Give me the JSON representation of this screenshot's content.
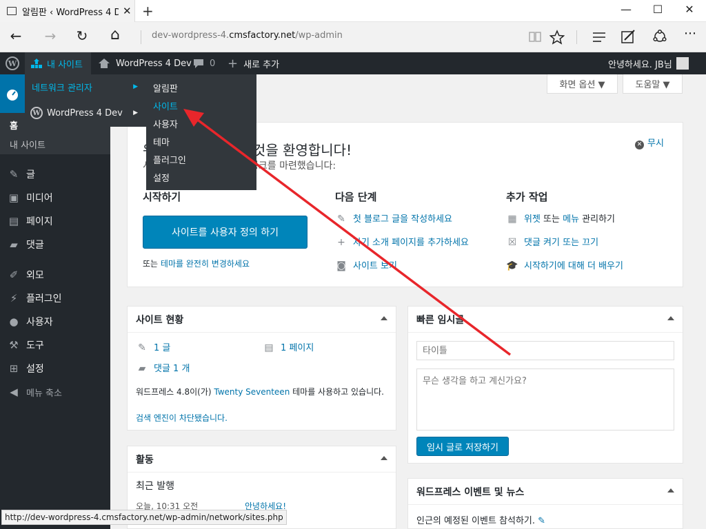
{
  "browser": {
    "tab_title": "알림판 ‹ WordPress 4 D",
    "tab_close": "✕",
    "new_tab": "+",
    "url_prefix": "dev-wordpress-4.",
    "url_domain": "cmsfactory.net",
    "url_path": "/wp-admin",
    "minimize": "—",
    "maximize": "☐",
    "close": "✕",
    "back": "←",
    "forward": "→",
    "refresh": "↻",
    "home": "⌂",
    "more": "···",
    "status_url": "http://dev-wordpress-4.cmsfactory.net/wp-admin/network/sites.php"
  },
  "adminbar": {
    "my_sites": "내 사이트",
    "site_name": "WordPress 4 Dev",
    "comments_count": "0",
    "new_content": "새로 추가",
    "greeting": "안녕하세요. JB님"
  },
  "flyout": {
    "network_admin": "네트워크 관리자",
    "site": "WordPress 4 Dev",
    "sub": [
      "알림판",
      "사이트",
      "사용자",
      "테마",
      "플러그인",
      "설정"
    ]
  },
  "sidebar": {
    "home": "홈",
    "my_sites": "내 사이트",
    "items": [
      "글",
      "미디어",
      "페이지",
      "댓글",
      "외모",
      "플러그인",
      "사용자",
      "도구",
      "설정"
    ],
    "collapse": "메뉴 축소"
  },
  "screen": {
    "options": "화면 옵션 ▼",
    "help": "도움말 ▼"
  },
  "welcome": {
    "title": "워드프레스에 오신 것을 환영합니다!",
    "subtitle": "시작하는데 도움이 되도록 링크를 마련했습니다:",
    "dismiss": "무시",
    "start_heading": "시작하기",
    "customize_button": "사이트를 사용자 정의 하기",
    "or_text": "또는",
    "theme_link": "테마를 완전히 변경하세요",
    "next_heading": "다음 단계",
    "next": [
      "첫 블로그 글을 작성하세요",
      "자기 소개 페이지를 추가하세요",
      "사이트 보기"
    ],
    "more_heading": "추가 작업",
    "more_1a": "위젯",
    "more_1b": " 또는 ",
    "more_1c": "메뉴",
    "more_1d": " 관리하기",
    "more_2": "댓글 켜기 또는 끄기",
    "more_3": "시작하기에 대해 더 배우기"
  },
  "glance": {
    "title": "사이트 현황",
    "posts": "1 글",
    "pages": "1 페이지",
    "comments": "댓글 1 개",
    "version_text_a": "워드프레스 4.8이(가) ",
    "version_theme": "Twenty Seventeen",
    "version_text_b": " 테마를 사용하고 있습니다.",
    "search_blocked": "검색 엔진이 차단됐습니다."
  },
  "activity": {
    "title": "활동",
    "recent": "최근 발행",
    "date": "오늘, 10:31 오전",
    "post": "안녕하세요!"
  },
  "quickdraft": {
    "title": "빠른 임시글",
    "title_placeholder": "타이틀",
    "content_placeholder": "무슨 생각을 하고 계신가요?",
    "save": "임시 글로 저장하기"
  },
  "events": {
    "title": "워드프레스 이벤트 및 뉴스",
    "text": "인근의 예정된 이벤트 참석하기."
  }
}
